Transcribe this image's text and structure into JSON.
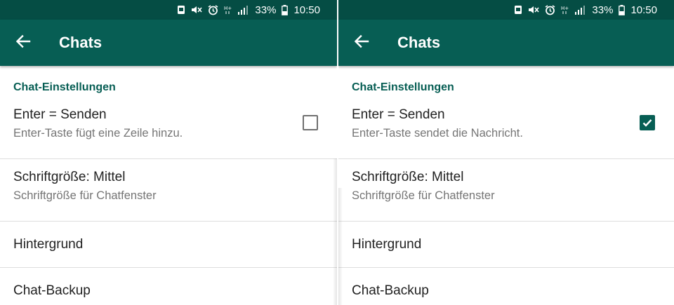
{
  "screens": [
    {
      "status": {
        "battery": "33%",
        "time": "10:50"
      },
      "appbar": {
        "title": "Chats"
      },
      "section": {
        "header": "Chat-Einstellungen"
      },
      "settings": [
        {
          "title": "Enter = Senden",
          "subtitle": "Enter-Taste fügt eine Zeile hinzu.",
          "checked": false
        },
        {
          "title": "Schriftgröße: Mittel",
          "subtitle": "Schriftgröße für Chatfenster"
        },
        {
          "title": "Hintergrund"
        },
        {
          "title": "Chat-Backup"
        }
      ]
    },
    {
      "status": {
        "battery": "33%",
        "time": "10:50"
      },
      "appbar": {
        "title": "Chats"
      },
      "section": {
        "header": "Chat-Einstellungen"
      },
      "settings": [
        {
          "title": "Enter = Senden",
          "subtitle": "Enter-Taste sendet die Nachricht.",
          "checked": true
        },
        {
          "title": "Schriftgröße: Mittel",
          "subtitle": "Schriftgröße für Chatfenster"
        },
        {
          "title": "Hintergrund"
        },
        {
          "title": "Chat-Backup"
        }
      ]
    }
  ],
  "colors": {
    "header": "#075e54",
    "statusbar": "#054d44",
    "accent": "#075e54"
  },
  "icons": [
    "back-arrow-icon",
    "alarm-icon",
    "mute-icon",
    "signal-icon",
    "battery-icon"
  ]
}
